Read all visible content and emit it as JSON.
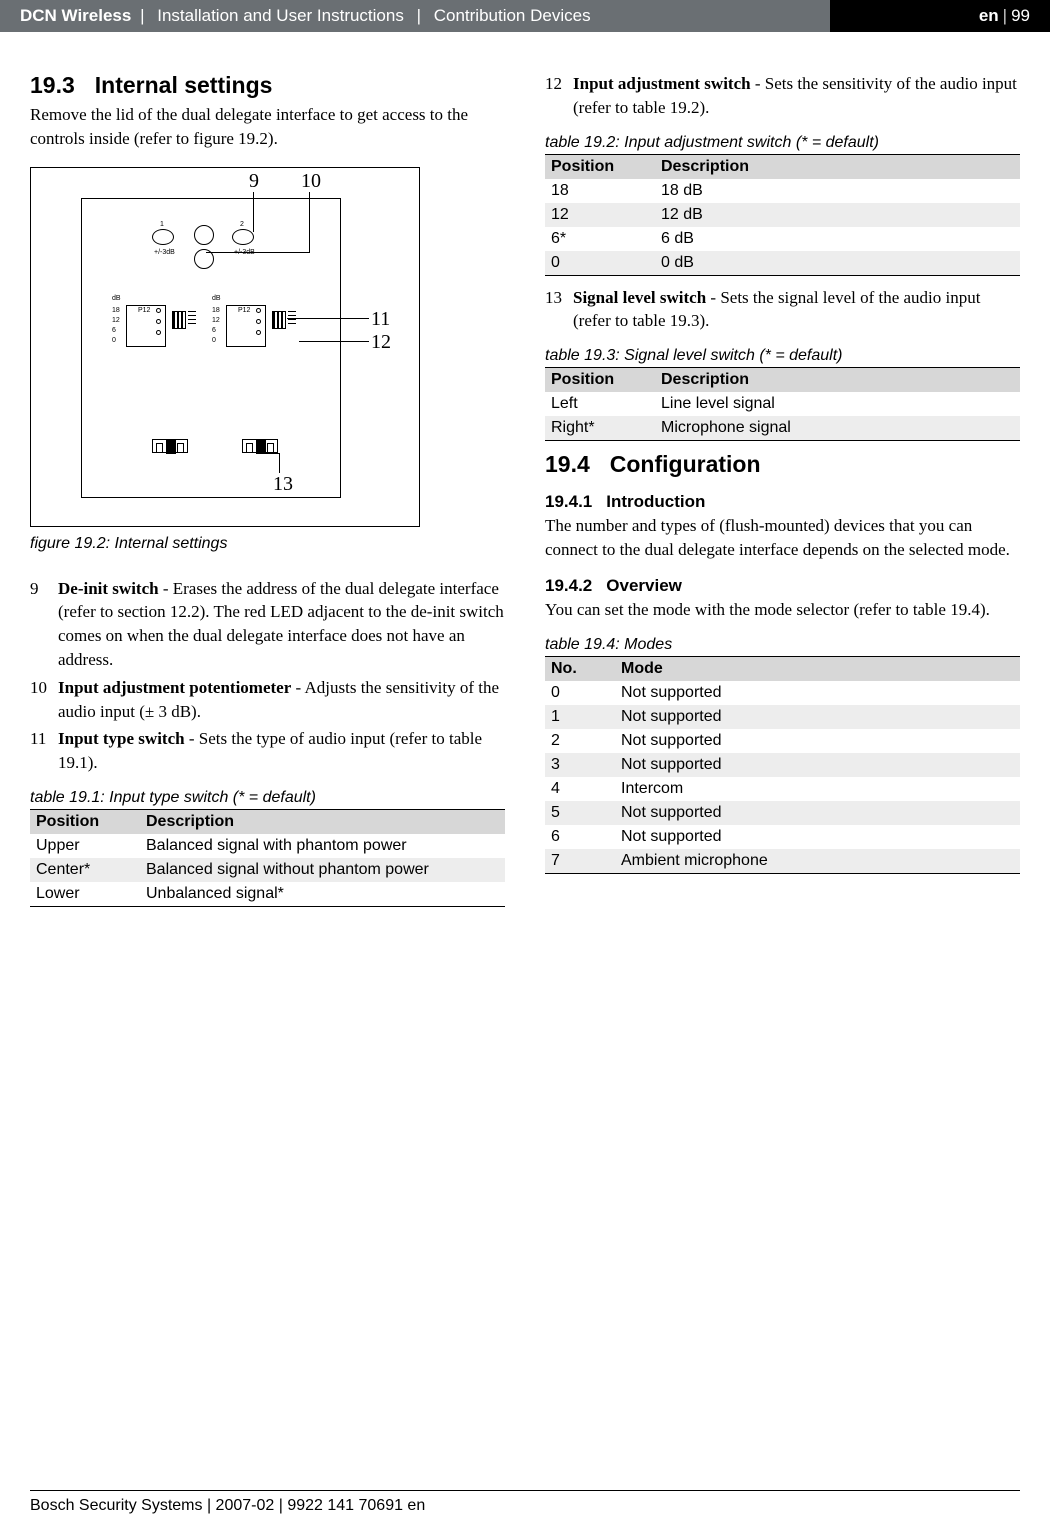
{
  "header": {
    "product": "DCN Wireless",
    "sep": " | ",
    "manual": "Installation and User Instructions",
    "section": "Contribution Devices",
    "lang": "en",
    "page": "99"
  },
  "left": {
    "h19_3_num": "19.3",
    "h19_3_title": "Internal settings",
    "p19_3": "Remove the lid of the dual delegate interface to get access to the controls inside (refer to figure 19.2).",
    "fig_caption": "figure 19.2: Internal settings",
    "callouts": {
      "c9": "9",
      "c10": "10",
      "c11": "11",
      "c12": "12",
      "c13": "13"
    },
    "fig_labels": {
      "ch1": "1",
      "ch2": "2",
      "pm3db_l": "+/-3dB",
      "pm3db_r": "+/-3dB",
      "dB_l": "dB",
      "dB_r": "dB",
      "scale": [
        "18",
        "12",
        "6",
        "0"
      ],
      "p12": "P12"
    },
    "list": [
      {
        "n": "9",
        "b": "De-init switch",
        "t": " - Erases the address of the dual delegate interface (refer to section 12.2). The red LED adjacent to the de-init switch comes on when the dual delegate interface does not have an address."
      },
      {
        "n": "10",
        "b": "Input adjustment potentiometer",
        "t": " - Adjusts the sensitivity of the audio input (± 3 dB)."
      },
      {
        "n": "11",
        "b": "Input type switch",
        "t": " - Sets the type of audio input (refer to table 19.1)."
      }
    ],
    "t19_1_caption": "table 19.1: Input type switch (* = default)",
    "t19_1_headers": [
      "Position",
      "Description"
    ],
    "t19_1_rows": [
      [
        "Upper",
        "Balanced signal with phantom power"
      ],
      [
        "Center*",
        "Balanced signal without phantom power"
      ],
      [
        "Lower",
        "Unbalanced signal*"
      ]
    ]
  },
  "right": {
    "list12": {
      "n": "12",
      "b": "Input adjustment switch",
      "t": " - Sets the sensitivity of the audio input (refer to table 19.2)."
    },
    "t19_2_caption": "table 19.2: Input adjustment switch (* = default)",
    "t19_2_headers": [
      "Position",
      "Description"
    ],
    "t19_2_rows": [
      [
        "18",
        "18 dB"
      ],
      [
        "12",
        "12 dB"
      ],
      [
        "6*",
        "6 dB"
      ],
      [
        "0",
        "0 dB"
      ]
    ],
    "list13": {
      "n": "13",
      "b": "Signal level switch",
      "t": " - Sets the signal level of the audio input (refer to table 19.3)."
    },
    "t19_3_caption": "table 19.3: Signal level switch (* = default)",
    "t19_3_headers": [
      "Position",
      "Description"
    ],
    "t19_3_rows": [
      [
        "Left",
        "Line level signal"
      ],
      [
        "Right*",
        "Microphone signal"
      ]
    ],
    "h19_4_num": "19.4",
    "h19_4_title": "Configuration",
    "h19_4_1_num": "19.4.1",
    "h19_4_1_title": "Introduction",
    "p19_4_1": "The number and types of (flush-mounted) devices that you can connect to the dual delegate interface depends on the selected mode.",
    "h19_4_2_num": "19.4.2",
    "h19_4_2_title": "Overview",
    "p19_4_2": "You can set the mode with the mode selector (refer to table 19.4).",
    "t19_4_caption": "table 19.4: Modes",
    "t19_4_headers": [
      "No.",
      "Mode"
    ],
    "t19_4_rows": [
      [
        "0",
        "Not supported"
      ],
      [
        "1",
        "Not supported"
      ],
      [
        "2",
        "Not supported"
      ],
      [
        "3",
        "Not supported"
      ],
      [
        "4",
        "Intercom"
      ],
      [
        "5",
        "Not supported"
      ],
      [
        "6",
        "Not supported"
      ],
      [
        "7",
        "Ambient microphone"
      ]
    ]
  },
  "footer": "Bosch Security Systems | 2007-02 | 9922 141 70691 en"
}
